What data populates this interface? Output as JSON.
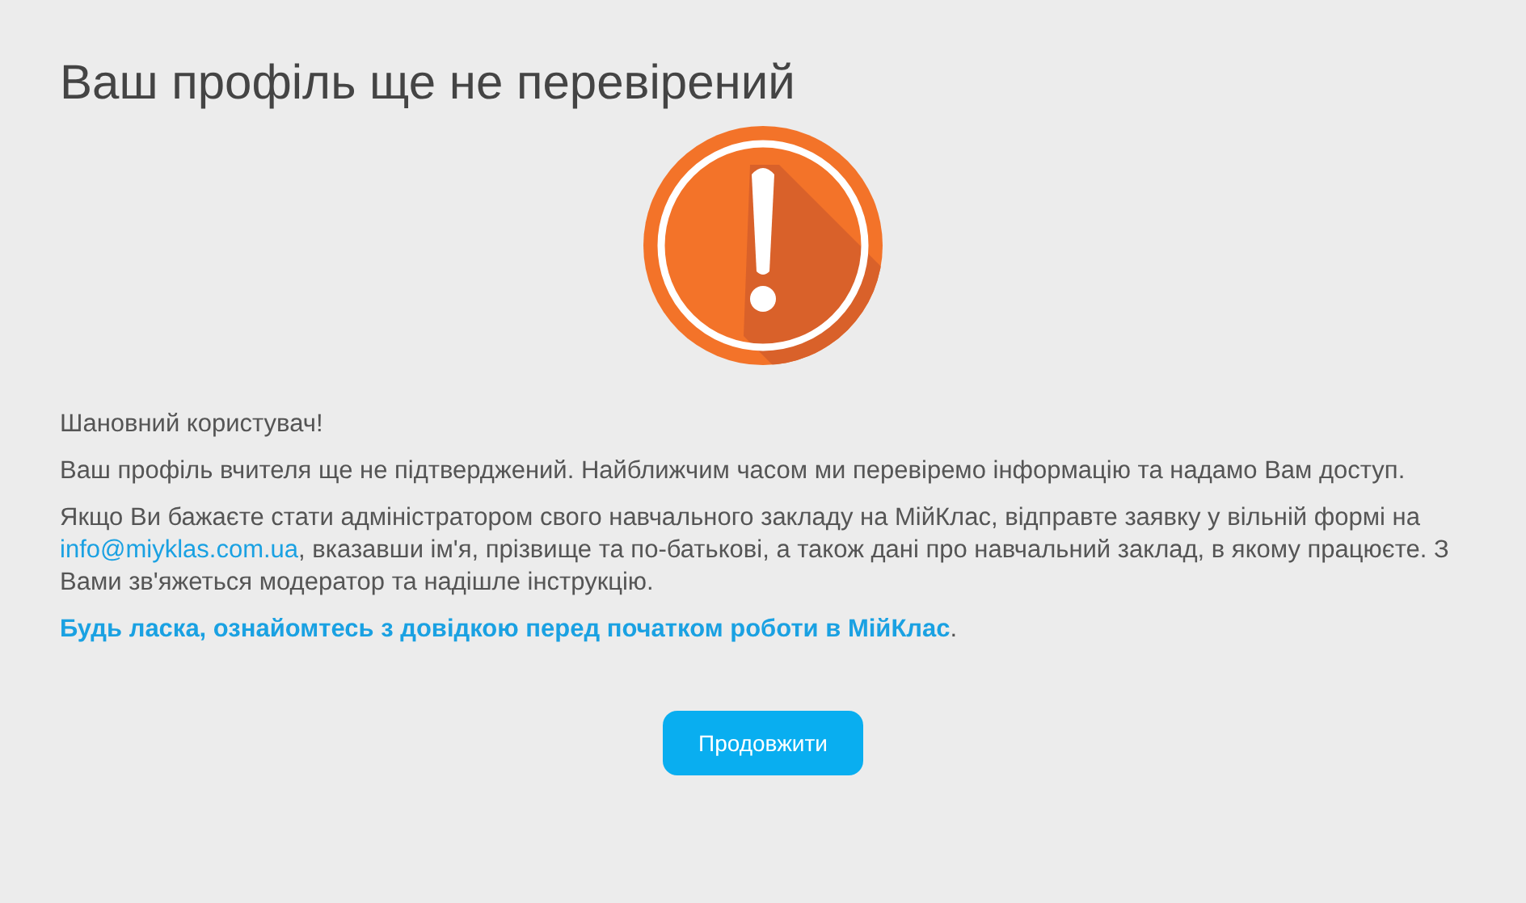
{
  "title": "Ваш профіль ще не перевірений",
  "paragraphs": [
    {
      "parts": [
        {
          "kind": "text",
          "text": "Шановний користувач!"
        }
      ]
    },
    {
      "parts": [
        {
          "kind": "text",
          "text": "Ваш профіль вчителя ще не підтверджений. Найближчим часом ми перевіремо інформацію та надамо Вам доступ."
        }
      ]
    },
    {
      "parts": [
        {
          "kind": "text",
          "text": "Якщо Ви бажаєте стати адміністратором свого навчального закладу на МійКлас, відправте заявку у вільній формі на "
        },
        {
          "kind": "link",
          "text": "info@miyklas.com.ua"
        },
        {
          "kind": "text",
          "text": ", вказавши ім'я, прізвище та по-батькові, а також дані про навчальний заклад, в якому працюєте. З Вами зв'яжеться модератор та надішле інструкцію."
        }
      ]
    },
    {
      "parts": [
        {
          "kind": "boldlink",
          "text": "Будь ласка, ознайомтесь з довідкою перед початком роботи в МійКлас"
        },
        {
          "kind": "text",
          "text": "."
        }
      ]
    }
  ],
  "button": "Продовжити"
}
